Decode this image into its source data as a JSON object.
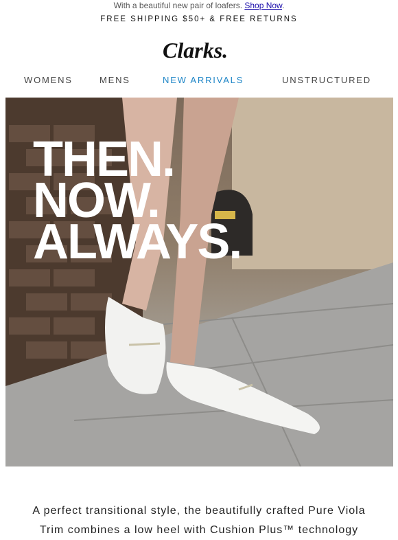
{
  "preheader": {
    "text": "With a beautiful new pair of loafers. ",
    "link": "Shop Now",
    "suffix": "."
  },
  "shipping": "FREE SHIPPING $50+ & FREE RETURNS",
  "brand": {
    "logo_text": "Clarks."
  },
  "nav": {
    "items": [
      {
        "label": "WOMENS"
      },
      {
        "label": "MENS"
      },
      {
        "label": "NEW ARRIVALS"
      },
      {
        "label": "UNSTRUCTURED"
      }
    ],
    "accent_color": "#1f86c7"
  },
  "hero": {
    "lines": [
      "THEN.",
      "NOW.",
      "ALWAYS."
    ]
  },
  "body_copy": "A perfect transitional style, the beautifully crafted Pure Viola Trim combines a low heel with Cushion Plus™ technology"
}
